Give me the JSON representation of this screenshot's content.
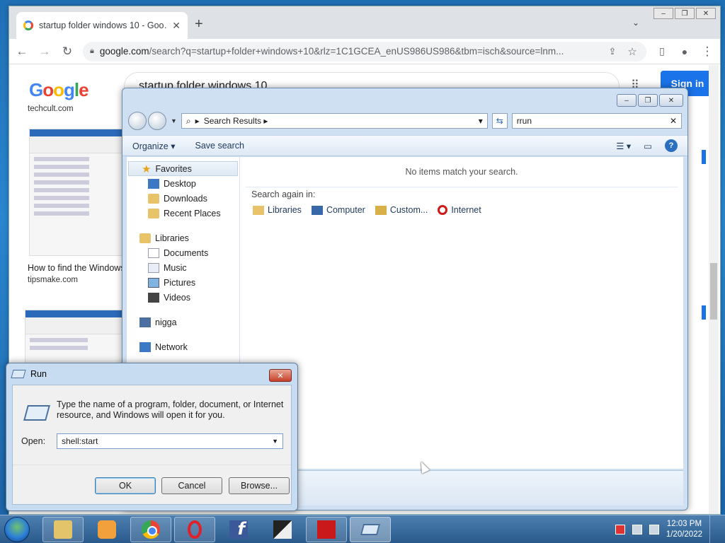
{
  "chrome": {
    "tab_title": "startup folder windows 10 - Goo…",
    "url_main": "google.com",
    "url_rest": "/search?q=startup+folder+windows+10&rlz=1C1GCEA_enUS986US986&tbm=isch&source=lnm...",
    "search_query": "startup folder windows 10",
    "signin_label": "Sign in",
    "results": [
      {
        "source": "techcult.com"
      },
      {
        "title": "How to find the Windows",
        "source": "tipsmake.com"
      }
    ],
    "icons": [
      "back-icon",
      "forward-icon",
      "reload-icon",
      "lock-icon",
      "share-icon",
      "star-icon",
      "sidepanel-icon",
      "profile-icon",
      "menu-icon"
    ]
  },
  "explorer": {
    "address_crumb": "Search Results",
    "search_value": "rrun",
    "toolbar": {
      "organize": "Organize",
      "save_search": "Save search"
    },
    "nav": {
      "favorites_header": "Favorites",
      "favorites": [
        "Desktop",
        "Downloads",
        "Recent Places"
      ],
      "libraries_header": "Libraries",
      "libraries": [
        "Documents",
        "Music",
        "Pictures",
        "Videos"
      ],
      "user": "nigga",
      "network": "Network"
    },
    "no_items": "No items match your search.",
    "search_again": "Search again in:",
    "search_again_links": [
      "Libraries",
      "Computer",
      "Custom...",
      "Internet"
    ]
  },
  "run": {
    "title": "Run",
    "description": "Type the name of a program, folder, document, or Internet resource, and Windows will open it for you.",
    "open_label": "Open:",
    "open_value": "shell:start",
    "ok": "OK",
    "cancel": "Cancel",
    "browse": "Browse..."
  },
  "taskbar": {
    "time": "12:03 PM",
    "date": "1/20/2022"
  }
}
